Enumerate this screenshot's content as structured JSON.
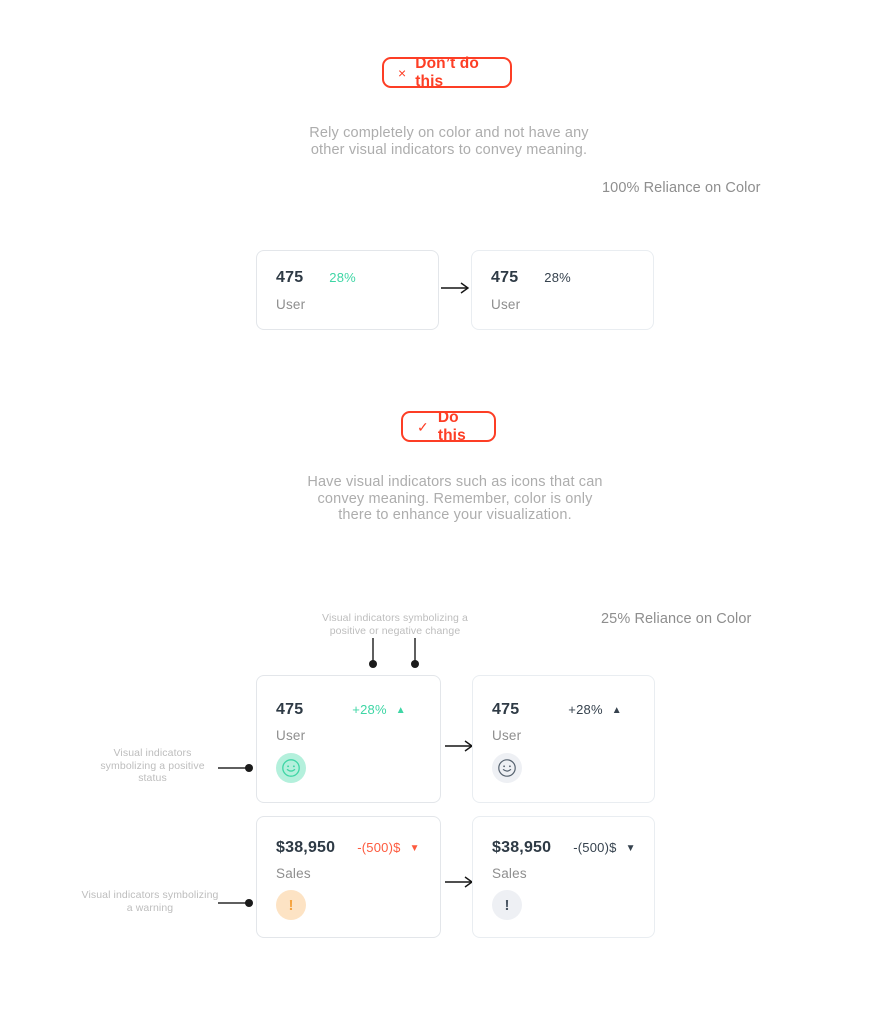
{
  "badges": {
    "dont": {
      "icon": "close-icon",
      "glyph": "×",
      "label": "Don’t do this",
      "color": "#fd3e25"
    },
    "do": {
      "icon": "check-icon",
      "glyph": "✓",
      "label": "Do this",
      "color": "#fd3e25"
    }
  },
  "sections": {
    "dont": {
      "description": "Rely completely on color and not have any other visual indicators to convey meaning.",
      "reliance_label": "100% Reliance on Color",
      "cards": [
        {
          "metric": "475",
          "delta": "28%",
          "delta_color": "#3ed6a5",
          "label": "User",
          "trend_icon": "",
          "status_icon": ""
        },
        {
          "metric": "475",
          "delta": "28%",
          "delta_color": "#36424e",
          "label": "User",
          "trend_icon": "",
          "status_icon": ""
        }
      ],
      "transform_arrow": "⟶"
    },
    "do": {
      "description": "Have visual indicators such as icons that can convey meaning. Remember, color is only there to enhance your visualization.",
      "reliance_label": "25% Reliance on Color",
      "callout_top": "Visual indicators symbolizing a positive or negative change",
      "callout_positive": "Visual indicators symbolizing a positive status",
      "callout_warning": "Visual indicators symbolizing a warning",
      "transform_arrow": "⟶",
      "rows": [
        {
          "left": {
            "metric": "475",
            "delta": "+28%",
            "delta_color": "#3ed6a5",
            "trend_icon": "triangle-up-icon",
            "trend_glyph": "▲",
            "label": "User",
            "status_icon": "smiley-face-icon",
            "bubble_color": "#b4f0dc",
            "stroke_color": "#3ed6a5"
          },
          "right": {
            "metric": "475",
            "delta": "+28%",
            "delta_color": "#36424e",
            "trend_icon": "triangle-up-icon",
            "trend_glyph": "▲",
            "label": "User",
            "status_icon": "smiley-face-icon",
            "bubble_color": "#eef0f4",
            "stroke_color": "#56626f"
          }
        },
        {
          "left": {
            "metric": "$38,950",
            "delta": "-(500)$",
            "delta_color": "#fd5a3e",
            "trend_icon": "triangle-down-icon",
            "trend_glyph": "▼",
            "label": "Sales",
            "status_icon": "warning-exclamation-icon",
            "bubble_color": "#fde3c4",
            "stroke_color": "#f5a33f",
            "bang": "!"
          },
          "right": {
            "metric": "$38,950",
            "delta": "-(500)$",
            "delta_color": "#36424e",
            "trend_icon": "triangle-down-icon",
            "trend_glyph": "▼",
            "label": "Sales",
            "status_icon": "warning-exclamation-icon",
            "bubble_color": "#eef0f4",
            "stroke_color": "#4a5663",
            "bang": "!"
          }
        }
      ]
    }
  }
}
